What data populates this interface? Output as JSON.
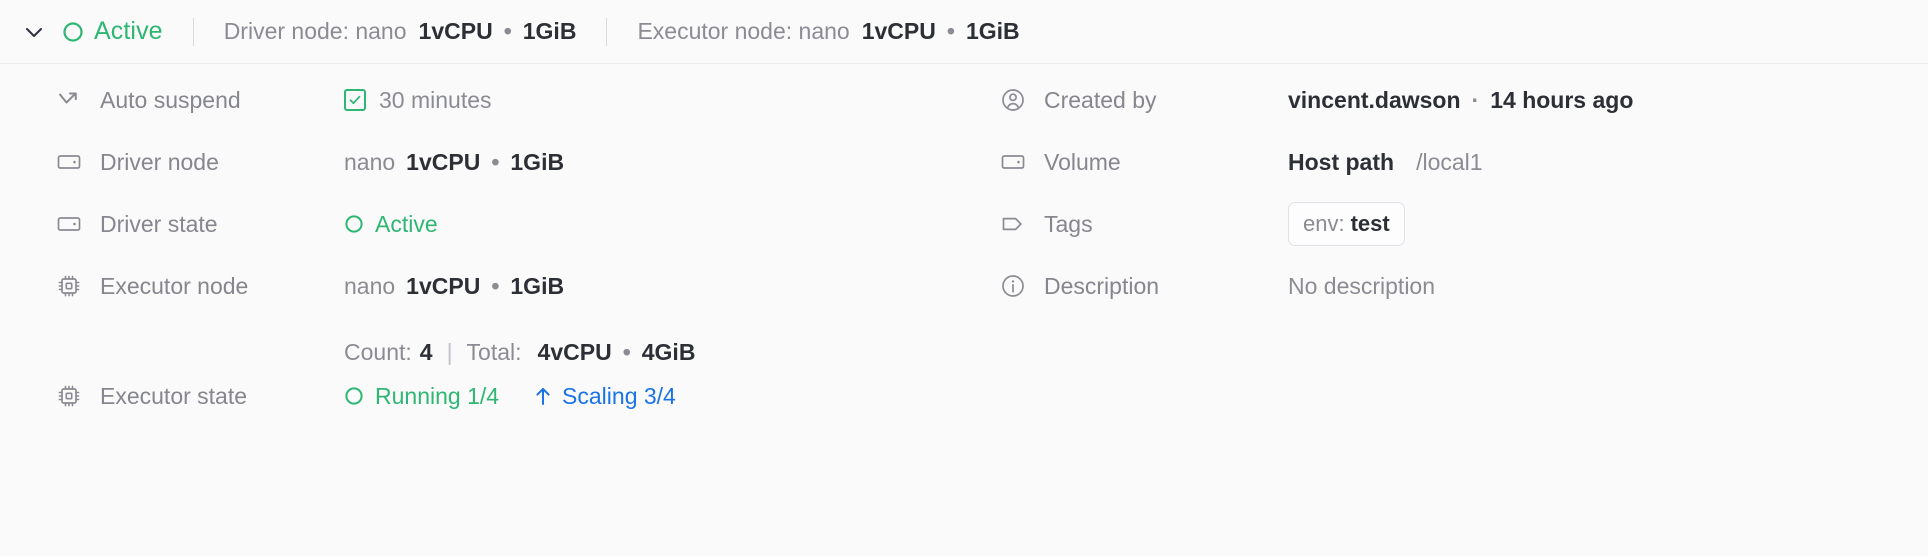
{
  "colors": {
    "green": "#2fb673",
    "blue": "#1a73e8",
    "muted": "#8b8b93",
    "dark": "#2c2f36",
    "background": "#fafafa"
  },
  "header": {
    "status": "Active",
    "segments": [
      {
        "label": "Driver node: nano",
        "cpu": "1vCPU",
        "separator": "•",
        "memory": "1GiB"
      },
      {
        "label": "Executor node: nano",
        "cpu": "1vCPU",
        "separator": "•",
        "memory": "1GiB"
      }
    ]
  },
  "left_column": {
    "rows": [
      {
        "label": "Auto suspend",
        "icon": "auto-suspend-arrow-icon",
        "value": "30 minutes"
      },
      {
        "label": "Driver node",
        "icon": "node-icon",
        "size": "nano",
        "cpu": "1vCPU",
        "separator": "•",
        "memory": "1GiB"
      },
      {
        "label": "Driver state",
        "icon": "node-icon",
        "state": "Active"
      },
      {
        "label": "Executor node",
        "icon": "cpu-chip-icon",
        "size": "nano",
        "cpu": "1vCPU",
        "separator": "•",
        "memory": "1GiB",
        "count_label": "Count:",
        "count_value": "4",
        "divider": "|",
        "total_label": "Total:",
        "total_cpu": "4vCPU",
        "total_separator": "•",
        "total_memory": "4GiB"
      },
      {
        "label": "Executor state",
        "icon": "cpu-chip-icon",
        "running": "Running 1/4",
        "scaling": "Scaling 3/4"
      }
    ]
  },
  "right_column": {
    "rows": [
      {
        "label": "Created by",
        "icon": "user-circle-icon",
        "user": "vincent.dawson",
        "separator": "·",
        "time": "14 hours ago"
      },
      {
        "label": "Volume",
        "icon": "node-icon",
        "kind": "Host path",
        "path": "/local1"
      },
      {
        "label": "Tags",
        "icon": "tag-icon",
        "tag_key": "env:",
        "tag_value": "test"
      },
      {
        "label": "Description",
        "icon": "info-circle-icon",
        "value": "No description"
      }
    ]
  }
}
